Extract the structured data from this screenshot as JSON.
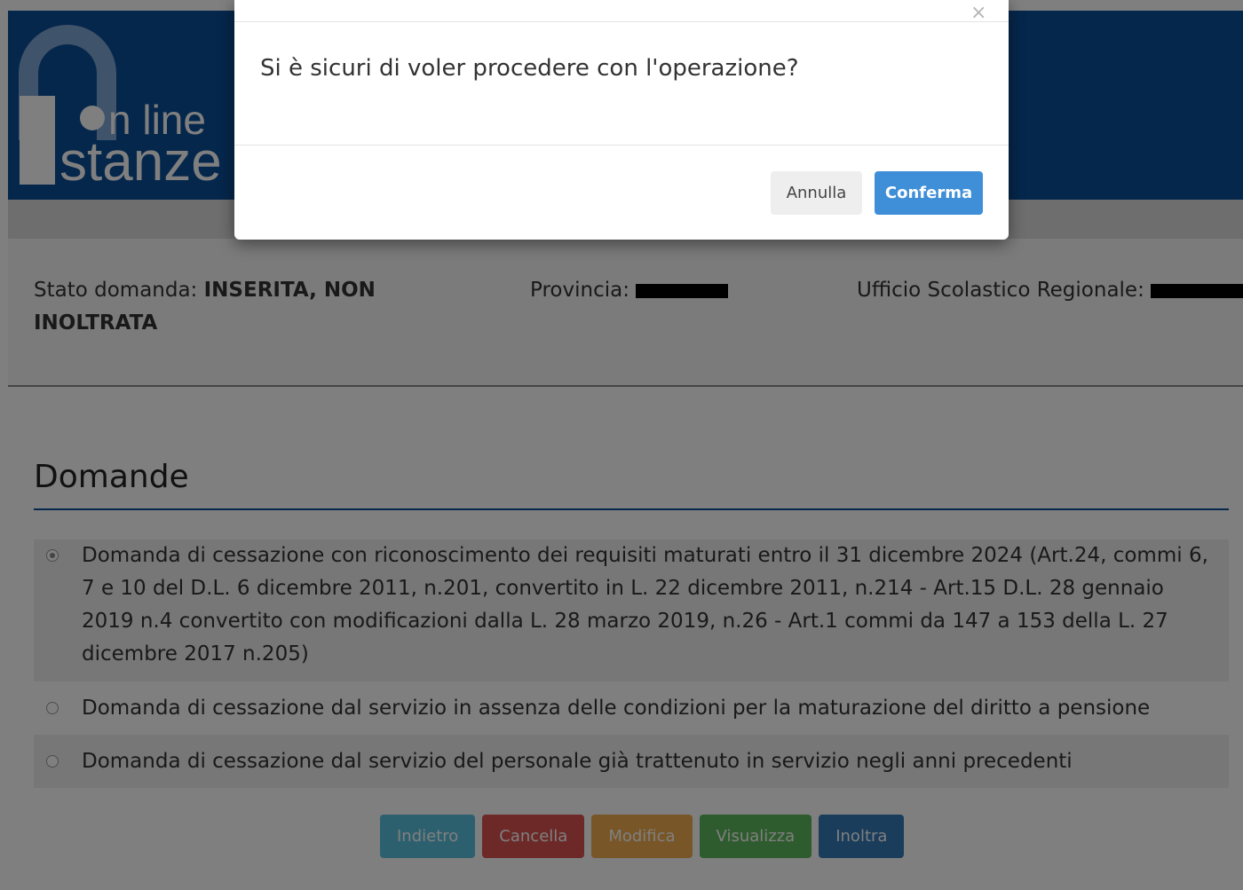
{
  "header": {
    "logo_line1": "n line",
    "logo_line2": "stanze"
  },
  "info": {
    "stato_label": "Stato domanda: ",
    "stato_value": "INSERITA, NON INOLTRATA",
    "provincia_label": "Provincia: ",
    "ufficio_label": "Ufficio Scolastico Regionale: "
  },
  "section": {
    "title": "Domande"
  },
  "options": [
    {
      "label": "Domanda di cessazione con riconoscimento dei requisiti maturati entro il 31 dicembre 2024 (Art.24, commi 6, 7 e 10 del D.L. 6 dicembre 2011, n.201, convertito in L. 22 dicembre 2011, n.214 - Art.15 D.L. 28 gennaio 2019 n.4 convertito con modificazioni dalla L. 28 marzo 2019, n.26 - Art.1 commi da 147 a 153 della L. 27 dicembre 2017 n.205)",
      "checked": true
    },
    {
      "label": "Domanda di cessazione dal servizio in assenza delle condizioni per la maturazione del diritto a pensione",
      "checked": false
    },
    {
      "label": "Domanda di cessazione dal servizio del personale già trattenuto in servizio negli anni precedenti",
      "checked": false
    }
  ],
  "actions": {
    "indietro": "Indietro",
    "cancella": "Cancella",
    "modifica": "Modifica",
    "visualizza": "Visualizza",
    "inoltra": "Inoltra"
  },
  "modal": {
    "close_symbol": "×",
    "message": "Si è sicuri di voler procedere con l'operazione?",
    "cancel_label": "Annulla",
    "confirm_label": "Conferma"
  },
  "colors": {
    "header_blue": "#0b4e99",
    "confirm_blue": "#3f8fd8",
    "indietro": "#5bc0de",
    "cancella": "#d9534f",
    "modifica": "#f0ad4e",
    "visualizza": "#5cb85c",
    "inoltra": "#337ab7"
  }
}
